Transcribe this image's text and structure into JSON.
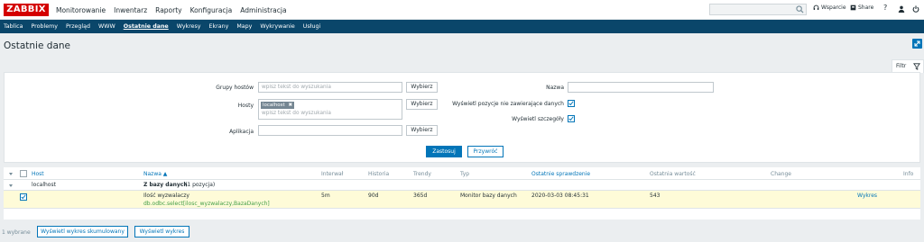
{
  "logo": "ZABBIX",
  "main_menu": [
    "Monitorowanie",
    "Inwentarz",
    "Raporty",
    "Konfiguracja",
    "Administracja"
  ],
  "topright": {
    "support": "Wsparcie",
    "share": "Share",
    "help": "?"
  },
  "sub_menu": [
    "Tablica",
    "Problemy",
    "Przegląd",
    "WWW",
    "Ostatnie dane",
    "Wykresy",
    "Ekrany",
    "Mapy",
    "Wykrywanie",
    "Usługi"
  ],
  "page_title": "Ostatnie dane",
  "filter": {
    "tab_label": "Filtr",
    "host_groups_label": "Grupy hostów",
    "host_groups_placeholder": "wpisz tekst do wyszukania",
    "select_label": "Wybierz",
    "hosts_label": "Hosty",
    "hosts_chip": "localhost",
    "hosts_placeholder": "wpisz tekst do wyszukania",
    "application_label": "Aplikacja",
    "name_label": "Nazwa",
    "show_no_data_label": "Wyświetl pozycje nie zawierające danych",
    "show_details_label": "Wyświetl szczegóły",
    "apply_label": "Zastosuj",
    "reset_label": "Przywróć"
  },
  "table": {
    "headers": {
      "host": "Host",
      "name": "Nazwa ▲",
      "interval": "Interwał",
      "history": "Historia",
      "trends": "Trendy",
      "type": "Typ",
      "last_check": "Ostatnie sprawdzenie",
      "last_value": "Ostatnia wartość",
      "change": "Change",
      "info": "Info"
    },
    "group": {
      "host": "localhost",
      "app": "Z bazy danych",
      "count": "(1 pozycja)"
    },
    "row": {
      "name": "Ilość wyzwalaczy",
      "key": "db.odbc.select[ilosc_wyzwalaczy,BazaDanych]",
      "interval": "5m",
      "history": "90d",
      "trends": "365d",
      "type": "Monitor bazy danych",
      "last_check": "2020-03-03 08:45:31",
      "last_value": "543",
      "change": "",
      "graph": "Wykres"
    }
  },
  "footer": {
    "selected": "1 wybrane",
    "stacked_graph": "Wyświetl wykres skumulowany",
    "graph": "Wyświetl wykres"
  }
}
